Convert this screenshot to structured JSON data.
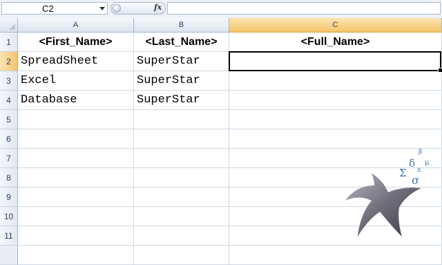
{
  "formula_bar": {
    "name_box": "C2",
    "fx_label": "fx",
    "formula": ""
  },
  "columns": [
    {
      "letter": "A",
      "active": false
    },
    {
      "letter": "B",
      "active": false
    },
    {
      "letter": "C",
      "active": true
    }
  ],
  "rows": [
    "1",
    "2",
    "3",
    "4",
    "5",
    "6",
    "7",
    "8",
    "9",
    "10",
    "11"
  ],
  "active_row": "2",
  "cells": {
    "A1": "<First_Name>",
    "B1": "<Last_Name>",
    "C1": "<Full_Name>",
    "A2": "SpreadSheet",
    "B2": "SuperStar",
    "C2": "",
    "A3": "Excel",
    "B3": "SuperStar",
    "A4": "Database",
    "B4": "SuperStar"
  },
  "logo_symbols": {
    "sigma": "Σ",
    "delta": "δ",
    "beta": "β",
    "mu": "μ",
    "plusminus": "±",
    "sigma_small": "σ"
  },
  "colors": {
    "active_header": "#f4c46b",
    "grid_line": "#d0d7e5",
    "header_text": "#27415f",
    "logo_blue": "#3d73b8"
  }
}
